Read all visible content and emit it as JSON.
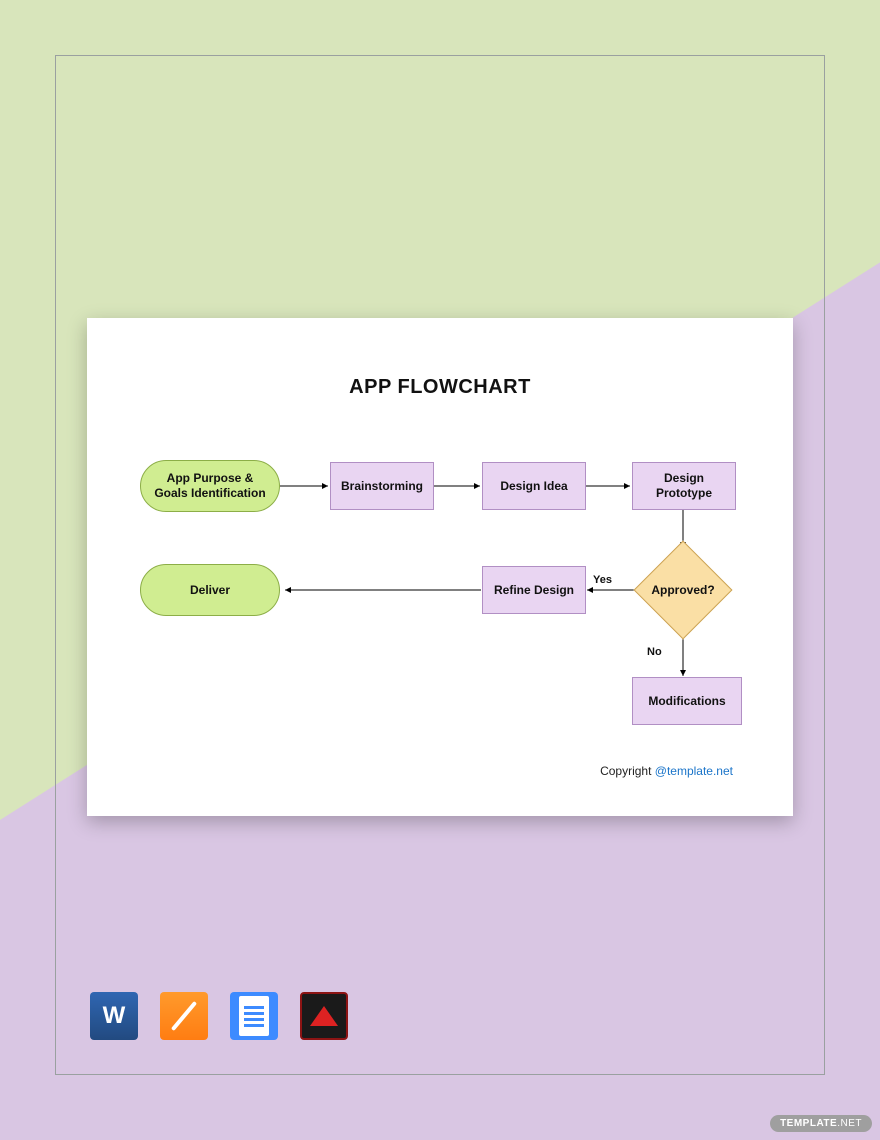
{
  "title": "APP FLOWCHART",
  "nodes": {
    "start": "App Purpose & Goals Identification",
    "brainstorm": "Brainstorming",
    "designIdea": "Design Idea",
    "prototype": "Design Prototype",
    "approved": "Approved?",
    "refine": "Refine Design",
    "deliver": "Deliver",
    "mod": "Modifications"
  },
  "edgeLabels": {
    "yes": "Yes",
    "no": "No"
  },
  "copyright": {
    "prefix": "Copyright ",
    "link": "@template.net"
  },
  "watermark": {
    "brand": "TEMPLATE",
    "tld": ".NET"
  },
  "formats": [
    "word",
    "pages",
    "gdocs",
    "pdf"
  ]
}
